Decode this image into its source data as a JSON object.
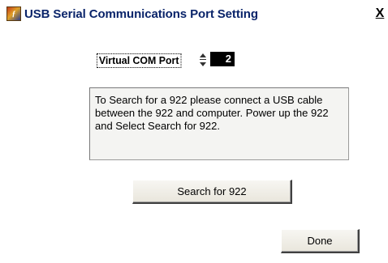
{
  "window": {
    "title": "USB Serial Communications Port Setting",
    "close_glyph": "X",
    "icon": "labview-app-icon"
  },
  "com_port": {
    "label": "Virtual COM Port",
    "value": "2"
  },
  "message": {
    "text": "To Search for a 922 please connect a USB cable between the 922 and computer.  Power up the 922 and Select Search for 922."
  },
  "buttons": {
    "search_label": "Search for 922",
    "done_label": "Done"
  },
  "colors": {
    "title_text": "#0a246a",
    "value_bg": "#000000",
    "value_fg": "#ffffff",
    "background": "#ffffff"
  }
}
